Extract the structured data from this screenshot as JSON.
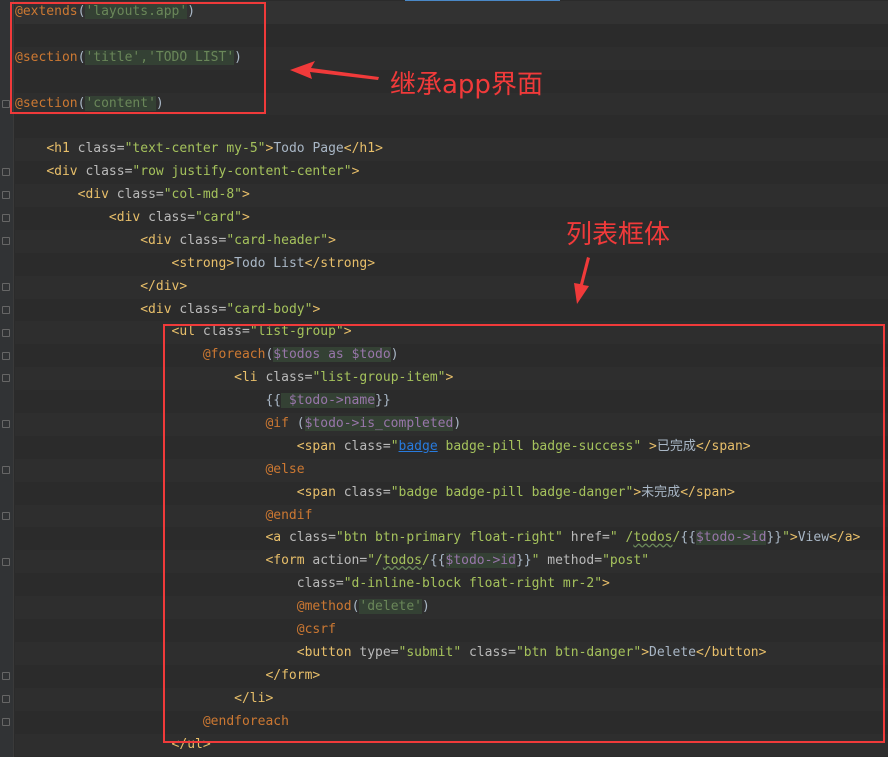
{
  "editor": {
    "lines": [
      [
        [
          "d",
          "@extends"
        ],
        [
          "p",
          "("
        ],
        [
          "s",
          "'layouts.app'"
        ],
        [
          "p",
          ")"
        ]
      ],
      [],
      [
        [
          "d",
          "@section"
        ],
        [
          "p",
          "("
        ],
        [
          "s",
          "'title','TODO LIST'"
        ],
        [
          "p",
          ")"
        ]
      ],
      [],
      [
        [
          "d",
          "@section"
        ],
        [
          "p",
          "("
        ],
        [
          "s",
          "'content'"
        ],
        [
          "p",
          ")"
        ]
      ],
      [],
      [
        [
          "x",
          "    "
        ],
        [
          "t",
          "<h1 "
        ],
        [
          "a",
          "class="
        ],
        [
          "v",
          "\"text-center my-5\""
        ],
        [
          "t",
          ">"
        ],
        [
          "x",
          "Todo Page"
        ],
        [
          "t",
          "</h1>"
        ]
      ],
      [
        [
          "x",
          "    "
        ],
        [
          "t",
          "<div "
        ],
        [
          "a",
          "class="
        ],
        [
          "v",
          "\"row justify-content-center\""
        ],
        [
          "t",
          ">"
        ]
      ],
      [
        [
          "x",
          "        "
        ],
        [
          "t",
          "<div "
        ],
        [
          "a",
          "class="
        ],
        [
          "v",
          "\"col-md-8\""
        ],
        [
          "t",
          ">"
        ]
      ],
      [
        [
          "x",
          "            "
        ],
        [
          "t",
          "<div "
        ],
        [
          "a",
          "class="
        ],
        [
          "v",
          "\"card\""
        ],
        [
          "t",
          ">"
        ]
      ],
      [
        [
          "x",
          "                "
        ],
        [
          "t",
          "<div "
        ],
        [
          "a",
          "class="
        ],
        [
          "v",
          "\"card-header\""
        ],
        [
          "t",
          ">"
        ]
      ],
      [
        [
          "x",
          "                    "
        ],
        [
          "t",
          "<strong>"
        ],
        [
          "x",
          "Todo List"
        ],
        [
          "t",
          "</strong>"
        ]
      ],
      [
        [
          "x",
          "                "
        ],
        [
          "t",
          "</div>"
        ]
      ],
      [
        [
          "x",
          "                "
        ],
        [
          "t",
          "<div "
        ],
        [
          "a",
          "class="
        ],
        [
          "v",
          "\"card-body\""
        ],
        [
          "t",
          ">"
        ]
      ],
      [
        [
          "x",
          "                    "
        ],
        [
          "t",
          "<ul "
        ],
        [
          "a",
          "class="
        ],
        [
          "v",
          "\"list-group\""
        ],
        [
          "t",
          ">"
        ]
      ],
      [
        [
          "x",
          "                        "
        ],
        [
          "d",
          "@foreach"
        ],
        [
          "p",
          "("
        ],
        [
          "var",
          "$todos as $todo"
        ],
        [
          "p",
          ")"
        ]
      ],
      [
        [
          "x",
          "                            "
        ],
        [
          "t",
          "<li "
        ],
        [
          "a",
          "class="
        ],
        [
          "v",
          "\"list-group-item\""
        ],
        [
          "t",
          ">"
        ]
      ],
      [
        [
          "x",
          "                                "
        ],
        [
          "p",
          "{{"
        ],
        [
          "var",
          " $todo->name"
        ],
        [
          "p",
          "}}"
        ]
      ],
      [
        [
          "x",
          "                                "
        ],
        [
          "d",
          "@if "
        ],
        [
          "p",
          "("
        ],
        [
          "var",
          "$todo->is_completed"
        ],
        [
          "p",
          ")"
        ]
      ],
      [
        [
          "x",
          "                                    "
        ],
        [
          "t",
          "<span "
        ],
        [
          "a",
          "class="
        ],
        [
          "v",
          "\""
        ],
        [
          "u",
          "badge"
        ],
        [
          "v",
          " badge-pill badge-success\" "
        ],
        [
          "t",
          ">"
        ],
        [
          "x",
          "已完成"
        ],
        [
          "t",
          "</span>"
        ]
      ],
      [
        [
          "x",
          "                                "
        ],
        [
          "d",
          "@else"
        ]
      ],
      [
        [
          "x",
          "                                    "
        ],
        [
          "t",
          "<span "
        ],
        [
          "a",
          "class="
        ],
        [
          "v",
          "\"badge badge-pill badge-danger\""
        ],
        [
          "t",
          ">"
        ],
        [
          "x",
          "未完成"
        ],
        [
          "t",
          "</span>"
        ]
      ],
      [
        [
          "x",
          "                                "
        ],
        [
          "d",
          "@endif"
        ]
      ],
      [
        [
          "x",
          "                                "
        ],
        [
          "t",
          "<a "
        ],
        [
          "a",
          "class="
        ],
        [
          "v",
          "\"btn btn-primary float-right\" "
        ],
        [
          "a",
          "href="
        ],
        [
          "v",
          "\" /"
        ],
        [
          "w",
          "todos"
        ],
        [
          "v",
          "/"
        ],
        [
          "p",
          "{{"
        ],
        [
          "var",
          "$todo->id"
        ],
        [
          "p",
          "}}"
        ],
        [
          "v",
          "\""
        ],
        [
          "t",
          ">"
        ],
        [
          "x",
          "View"
        ],
        [
          "t",
          "</a>"
        ]
      ],
      [
        [
          "x",
          "                                "
        ],
        [
          "t",
          "<form "
        ],
        [
          "a",
          "action="
        ],
        [
          "v",
          "\"/"
        ],
        [
          "w",
          "todos"
        ],
        [
          "v",
          "/"
        ],
        [
          "p",
          "{{"
        ],
        [
          "var",
          "$todo->id"
        ],
        [
          "p",
          "}}"
        ],
        [
          "v",
          "\" "
        ],
        [
          "a",
          "method="
        ],
        [
          "v",
          "\"post\""
        ]
      ],
      [
        [
          "x",
          "                                    "
        ],
        [
          "a",
          "class="
        ],
        [
          "v",
          "\"d-inline-block float-right mr-2\""
        ],
        [
          "t",
          ">"
        ]
      ],
      [
        [
          "x",
          "                                    "
        ],
        [
          "d",
          "@method"
        ],
        [
          "p",
          "("
        ],
        [
          "s",
          "'delete'"
        ],
        [
          "p",
          ")"
        ]
      ],
      [
        [
          "x",
          "                                    "
        ],
        [
          "d",
          "@csrf"
        ]
      ],
      [
        [
          "x",
          "                                    "
        ],
        [
          "t",
          "<button "
        ],
        [
          "a",
          "type="
        ],
        [
          "v",
          "\"submit\" "
        ],
        [
          "a",
          "class="
        ],
        [
          "v",
          "\"btn btn-danger\""
        ],
        [
          "t",
          ">"
        ],
        [
          "x",
          "Delete"
        ],
        [
          "t",
          "</button>"
        ]
      ],
      [
        [
          "x",
          "                                "
        ],
        [
          "t",
          "</form>"
        ]
      ],
      [
        [
          "x",
          "                            "
        ],
        [
          "t",
          "</li>"
        ]
      ],
      [
        [
          "x",
          "                        "
        ],
        [
          "d",
          "@endforeach"
        ]
      ],
      [
        [
          "x",
          "                    "
        ],
        [
          "t",
          "</ul>"
        ]
      ]
    ]
  },
  "annotations": {
    "inherit_note": "继承app界面",
    "list_note": "列表框体",
    "color": "#f03a3a"
  }
}
